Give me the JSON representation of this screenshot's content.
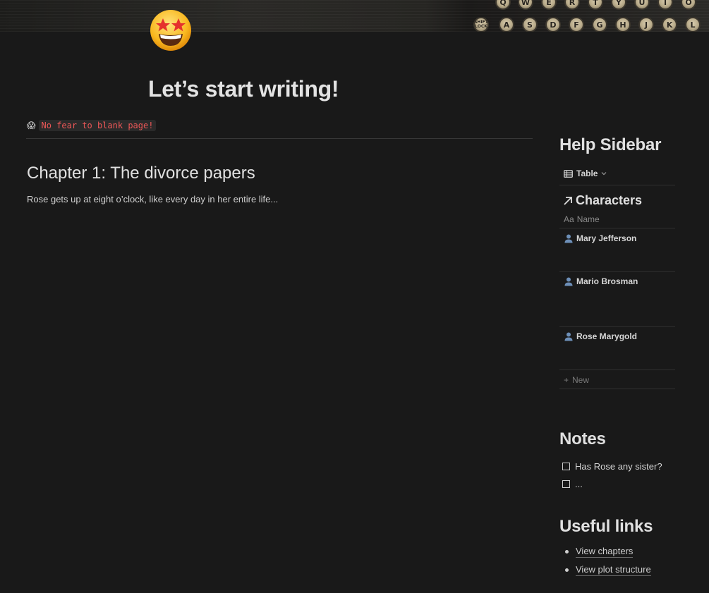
{
  "cover": {
    "keys_top": [
      "Q",
      "W",
      "E",
      "R",
      "T",
      "Y",
      "U",
      "I",
      "O"
    ],
    "keys_bottom": [
      "SHIFT LOCK",
      "A",
      "S",
      "D",
      "F",
      "G",
      "H",
      "J",
      "K",
      "L"
    ]
  },
  "page": {
    "icon": "star-struck-emoji-icon",
    "title": "Let’s start writing!",
    "callout_emoji": "😱",
    "callout_code": "No fear to blank page!",
    "chapter_heading": "Chapter 1: The divorce papers",
    "chapter_text": "Rose gets up at eight o’clock, like every day in her entire life..."
  },
  "sidebar": {
    "heading": "Help Sidebar",
    "view_label": "Table",
    "database_title": "Characters",
    "column_header": "Name",
    "column_icon_text": "Aa",
    "characters": [
      {
        "name": "Mary Jefferson"
      },
      {
        "name": "Mario Brosman"
      },
      {
        "name": "Rose Marygold"
      }
    ],
    "new_label": "New",
    "notes_heading": "Notes",
    "notes": [
      {
        "text": "Has Rose any sister?",
        "checked": false
      },
      {
        "text": "...",
        "checked": false
      }
    ],
    "links_heading": "Useful links",
    "links": [
      {
        "label": "View chapters"
      },
      {
        "label": "View plot structure"
      }
    ]
  }
}
